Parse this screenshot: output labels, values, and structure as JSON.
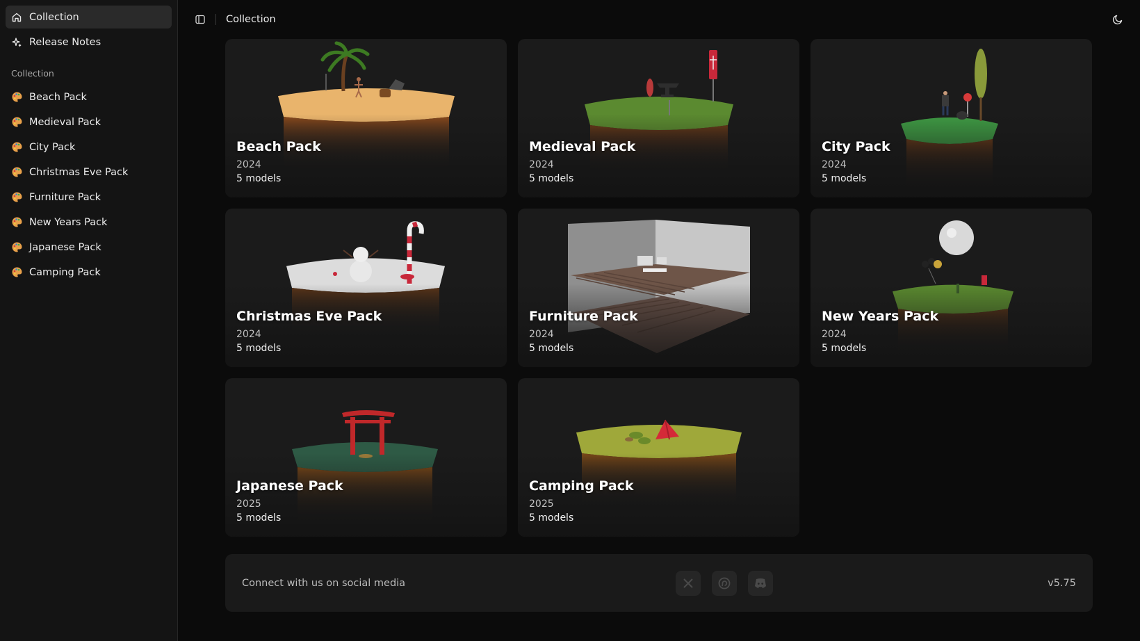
{
  "sidebar": {
    "nav": [
      {
        "label": "Collection",
        "icon": "home-icon",
        "active": true
      },
      {
        "label": "Release Notes",
        "icon": "sparkle-icon",
        "active": false
      }
    ],
    "section_label": "Collection",
    "packs": [
      {
        "label": "Beach Pack"
      },
      {
        "label": "Medieval Pack"
      },
      {
        "label": "City Pack"
      },
      {
        "label": "Christmas Eve Pack"
      },
      {
        "label": "Furniture Pack"
      },
      {
        "label": "New Years Pack"
      },
      {
        "label": "Japanese Pack"
      },
      {
        "label": "Camping Pack"
      }
    ]
  },
  "header": {
    "breadcrumb": "Collection"
  },
  "cards": [
    {
      "title": "Beach Pack",
      "year": "2024",
      "count": "5 models",
      "scene": "beach"
    },
    {
      "title": "Medieval Pack",
      "year": "2024",
      "count": "5 models",
      "scene": "medieval"
    },
    {
      "title": "City Pack",
      "year": "2024",
      "count": "5 models",
      "scene": "city"
    },
    {
      "title": "Christmas Eve Pack",
      "year": "2024",
      "count": "5 models",
      "scene": "christmas"
    },
    {
      "title": "Furniture Pack",
      "year": "2024",
      "count": "5 models",
      "scene": "furniture"
    },
    {
      "title": "New Years Pack",
      "year": "2024",
      "count": "5 models",
      "scene": "newyears"
    },
    {
      "title": "Japanese Pack",
      "year": "2025",
      "count": "5 models",
      "scene": "japanese"
    },
    {
      "title": "Camping Pack",
      "year": "2025",
      "count": "5 models",
      "scene": "camping"
    }
  ],
  "footer": {
    "text": "Connect with us on social media",
    "socials": [
      "x-logo-icon",
      "threads-logo-icon",
      "discord-logo-icon"
    ],
    "version": "v5.75"
  },
  "colors": {
    "background": "#0b0b0b",
    "sidebar": "#141414",
    "card": "#1b1b1b",
    "active_item": "#2a2a2a",
    "sand": "#e9b36a",
    "grass": "#5d8a32",
    "city_grass": "#3f9a44",
    "snow": "#e6e6e6",
    "soil": "#7a3f18",
    "torii_red": "#c0282a",
    "tent_red": "#d42a38"
  }
}
